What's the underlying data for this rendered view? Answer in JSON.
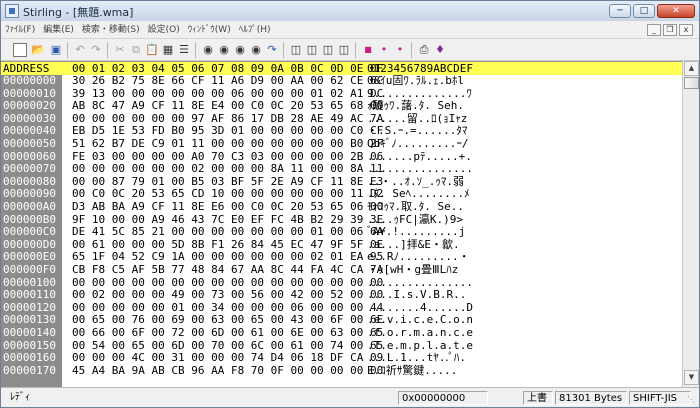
{
  "window": {
    "title": "Stirling - [無題.wma]"
  },
  "menu": [
    "ﾌｧｲﾙ(F)",
    "編集(E)",
    "検索・移動(S)",
    "設定(O)",
    "ｳｨﾝﾄﾞｳ(W)",
    "ﾍﾙﾌﾟ(H)"
  ],
  "toolbar_icons": [
    "new-file-icon",
    "open-folder-icon",
    "save-icon",
    "undo-icon",
    "redo-icon",
    "cut-icon",
    "copy-icon",
    "paste-icon",
    "delete-icon",
    "select-all-icon",
    "find-icon",
    "find-next-icon",
    "find-prev-icon",
    "replace-icon",
    "jump-icon",
    "bookmark-icon",
    "bookmark-next-icon",
    "bookmark-prev-icon",
    "bookmark-clear-icon",
    "macro-icon",
    "macro-play-icon",
    "macro-record-icon",
    "print-icon",
    "help-icon"
  ],
  "hex": {
    "header": {
      "address": "ADDRESS",
      "offsets": "00 01 02 03 04 05 06 07 08 09 0A 0B 0C 0D 0E 0F",
      "ascii": "0123456789ABCDEF"
    },
    "rows": [
      {
        "addr": "00000000",
        "hex": "30 26 B2 75 8E 66 CF 11 A6 D9 00 AA 00 62 CE 6C",
        "ascii": "0&ｲu固ﾜ.ﾗﾙ.ｪ.bﾎl"
      },
      {
        "addr": "00000010",
        "hex": "39 13 00 00 00 00 00 00 06 00 00 00 01 02 A1 DC",
        "ascii": "9..............ﾜ"
      },
      {
        "addr": "00000020",
        "hex": "AB 8C 47 A9 CF 11 8E E4 00 C0 0C 20 53 65 68 00",
        "ascii": "ｫ醍ｩﾜ.藷.ﾀ. Seh."
      },
      {
        "addr": "00000030",
        "hex": "00 00 00 00 00 00 97 AF 86 17 DB 28 AE 49 AC 7A",
        "ascii": "......留..ﾛ(ｮIｬz"
      },
      {
        "addr": "00000040",
        "hex": "EB D5 1E 53 FD B0 95 3D 01 00 00 00 00 00 C0 CF",
        "ascii": "・.S.ｰ.=......ﾀﾏ"
      },
      {
        "addr": "00000050",
        "hex": "51 62 B7 DE C9 01 11 00 00 00 00 00 00 00 B0 2F",
        "ascii": "Qbｷﾞﾉ.........ｰ/"
      },
      {
        "addr": "00000060",
        "hex": "FE 03 00 00 00 00 A0 70 C3 03 00 00 00 00 2B 06",
        "ascii": ".......pﾃ.....+."
      },
      {
        "addr": "00000070",
        "hex": "00 00 00 00 00 00 02 00 00 00 8A 11 00 00 8A 11",
        "ascii": "................"
      },
      {
        "addr": "00000080",
        "hex": "00 00 87 79 01 00 B5 03 BF 5F 2E A9 CF 11 8E E3",
        "ascii": "..・..ｵ.ｿ_.ｩﾏ.弱"
      },
      {
        "addr": "00000090",
        "hex": "00 C0 0C 20 53 65 CD 10 00 00 00 00 00 00 11 D2",
        "ascii": ".ﾀ. Seﾍ........ﾒ"
      },
      {
        "addr": "000000A0",
        "hex": "D3 AB BA A9 CF 11 8E E6 00 C0 0C 20 53 65 06 00",
        "ascii": "ﾓｫｺｩﾏ.取.ﾀ. Se.."
      },
      {
        "addr": "000000B0",
        "hex": "9F 10 00 00 A9 46 43 7C E0 EF FC 4B B2 29 39 3E",
        "ascii": "....ｩFC|瀛K.)9>"
      },
      {
        "addr": "000000C0",
        "hex": "DE 41 5C 85 21 00 00 00 00 00 00 00 01 00 06 6A",
        "ascii": "ﾞA¥.!.........j"
      },
      {
        "addr": "000000D0",
        "hex": "00 61 00 00 00 5D 8B F1 26 84 45 EC 47 9F 5F 0E",
        "ascii": ".a...]拝&E・歙."
      },
      {
        "addr": "000000E0",
        "hex": "65 1F 04 52 C9 1A 00 00 00 00 00 00 02 01 EA 95",
        "ascii": "e..Rﾉ.........・"
      },
      {
        "addr": "000000F0",
        "hex": "CB F8 C5 AF 5B 77 48 84 67 AA 8C 44 FA 4C CA 7A",
        "ascii": "・ｯ[wH・g畳ⅢLﾊz"
      },
      {
        "addr": "00000100",
        "hex": "00 00 00 00 00 00 00 00 00 00 00 00 00 00 00 00",
        "ascii": "................"
      },
      {
        "addr": "00000110",
        "hex": "00 02 00 00 00 49 00 73 00 56 00 42 00 52 00 00",
        "ascii": "....I.s.V.B.R.."
      },
      {
        "addr": "00000120",
        "hex": "00 00 00 00 00 01 00 34 00 00 00 06 00 00 00 44",
        "ascii": "........4......D"
      },
      {
        "addr": "00000130",
        "hex": "00 65 00 76 00 69 00 63 00 65 00 43 00 6F 00 6E",
        "ascii": ".e.v.i.c.e.C.o.n"
      },
      {
        "addr": "00000140",
        "hex": "00 66 00 6F 00 72 00 6D 00 61 00 6E 00 63 00 65",
        "ascii": ".f.o.r.m.a.n.c.e"
      },
      {
        "addr": "00000150",
        "hex": "00 54 00 65 00 6D 00 70 00 6C 00 61 00 74 00 65",
        "ascii": ".T.e.m.p.l.a.t.e"
      },
      {
        "addr": "00000160",
        "hex": "00 00 00 4C 00 31 00 00 00 74 D4 06 18 DF CA 09",
        "ascii": "...L.1...tﾔ..ﾟﾊ."
      },
      {
        "addr": "00000170",
        "hex": "45 A4 BA 9A AB CB 96 AA F8 70 0F 00 00 00 00 00",
        "ascii": "E.ｺ祈ｻ驚鍵....."
      }
    ]
  },
  "status": {
    "left": "ﾚﾃﾞｨ",
    "address": "0x00000000",
    "mode": "上書",
    "size": "81301 Bytes",
    "encoding": "SHIFT-JIS"
  }
}
